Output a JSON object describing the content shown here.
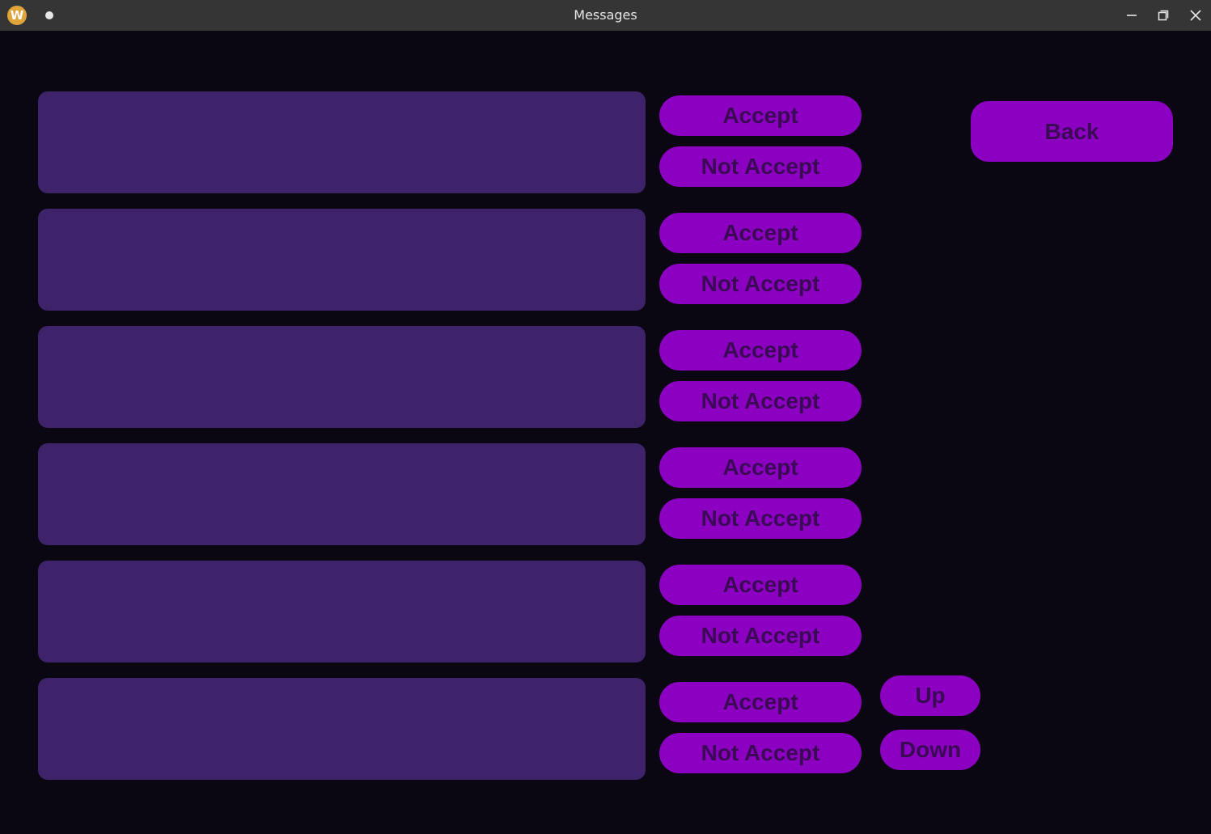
{
  "window": {
    "title": "Messages",
    "app_icon_letter": "W",
    "app_icon": "wolfram-w-icon",
    "controls": [
      "minimize-icon",
      "restore-icon",
      "close-icon"
    ]
  },
  "colors": {
    "background": "#0a0612",
    "titlebar": "#353535",
    "message_box": "#3e236a",
    "button": "#8c00c2",
    "button_text": "#3a0a55"
  },
  "messages": [
    {
      "text": "",
      "accept_label": "Accept",
      "not_accept_label": "Not Accept"
    },
    {
      "text": "",
      "accept_label": "Accept",
      "not_accept_label": "Not Accept"
    },
    {
      "text": "",
      "accept_label": "Accept",
      "not_accept_label": "Not Accept"
    },
    {
      "text": "",
      "accept_label": "Accept",
      "not_accept_label": "Not Accept"
    },
    {
      "text": "",
      "accept_label": "Accept",
      "not_accept_label": "Not Accept"
    },
    {
      "text": "",
      "accept_label": "Accept",
      "not_accept_label": "Not Accept"
    }
  ],
  "nav": {
    "back_label": "Back",
    "up_label": "Up",
    "down_label": "Down"
  }
}
